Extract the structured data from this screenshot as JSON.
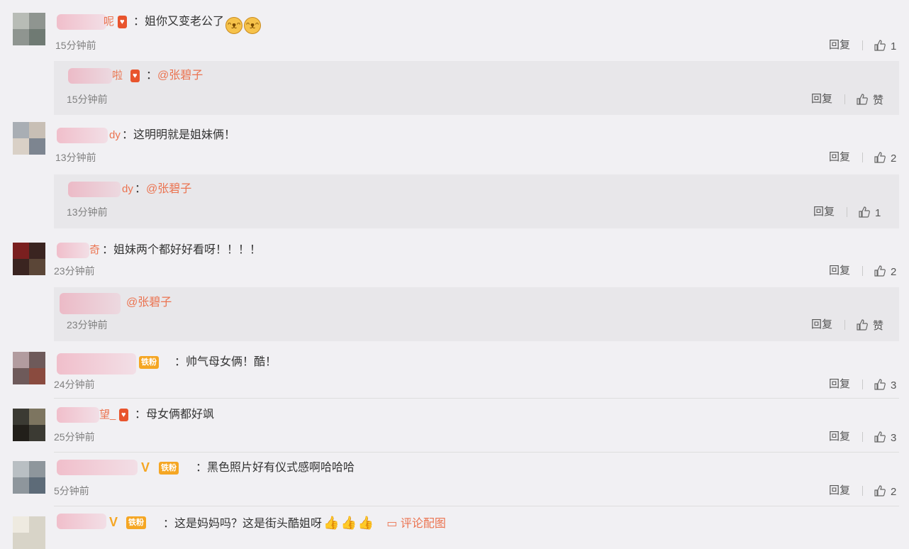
{
  "reply_label": "回复",
  "like_label": "赞",
  "pic_link_label": "评论配图",
  "comments": [
    {
      "name_tail": "呢",
      "text": "：姐你又变老公了",
      "time": "15分钟前",
      "likes": "1"
    },
    {
      "name_tail": "啦",
      "text": "：",
      "at": "@张碧子",
      "time": "15分钟前",
      "likes": "赞"
    },
    {
      "name_tail": "dy",
      "text": "：这明明就是姐妹俩！",
      "time": "13分钟前",
      "likes": "2"
    },
    {
      "name_tail": "dy",
      "text": "：",
      "at": "@张碧子",
      "time": "13分钟前",
      "likes": "1"
    },
    {
      "name_tail": "奇",
      "text": "：姐妹两个都好好看呀！！！！",
      "time": "23分钟前",
      "likes": "2"
    },
    {
      "name_tail": "",
      "text": "",
      "at": "@张碧子",
      "time": "23分钟前",
      "likes": "赞"
    },
    {
      "name_tail": "",
      "badge": "铁粉",
      "text": "：帅气母女俩！酷！",
      "time": "24分钟前",
      "likes": "3"
    },
    {
      "name_tail": "望_",
      "text": "：母女俩都好飒",
      "time": "25分钟前",
      "likes": "3"
    },
    {
      "name_tail": "",
      "vip": "V",
      "badge": "铁粉",
      "text": "：黑色照片好有仪式感啊哈哈哈",
      "time": "5分钟前",
      "likes": "2"
    },
    {
      "name_tail": "",
      "vip": "V",
      "badge": "铁粉",
      "text": "：这是妈妈吗？这是街头酷姐呀",
      "time": "",
      "likes": ""
    }
  ]
}
